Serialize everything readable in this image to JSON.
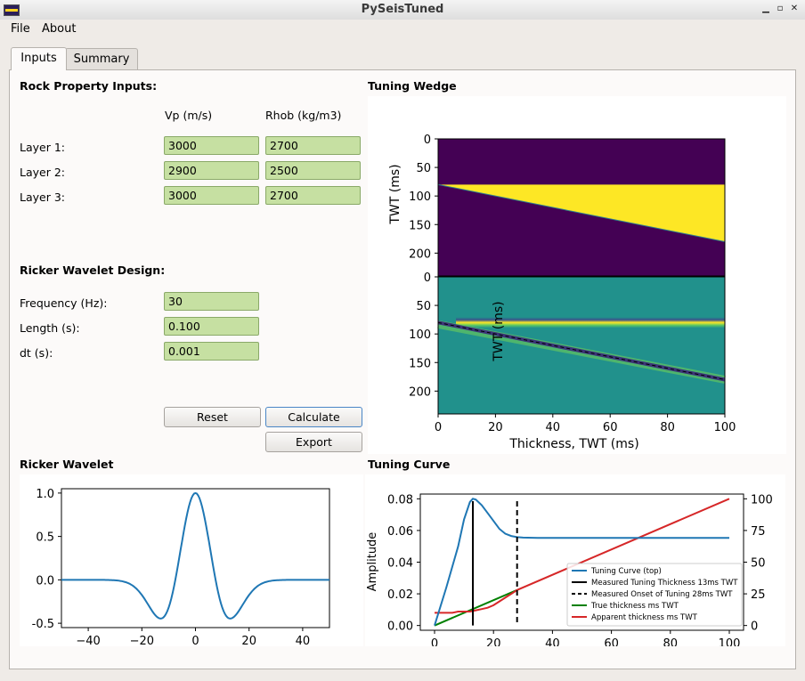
{
  "window": {
    "title": "PySeisTuned"
  },
  "menu": {
    "file": "File",
    "about": "About"
  },
  "tabs": {
    "inputs": "Inputs",
    "summary": "Summary"
  },
  "rock": {
    "heading": "Rock Property Inputs:",
    "col_vp": "Vp (m/s)",
    "col_rhob": "Rhob (kg/m3)",
    "layers": [
      {
        "label": "Layer 1:",
        "vp": "3000",
        "rhob": "2700"
      },
      {
        "label": "Layer 2:",
        "vp": "2900",
        "rhob": "2500"
      },
      {
        "label": "Layer 3:",
        "vp": "3000",
        "rhob": "2700"
      }
    ]
  },
  "wavelet": {
    "heading": "Ricker Wavelet Design:",
    "frequency_label": "Frequency (Hz):",
    "frequency": "30",
    "length_label": "Length (s):",
    "length": "0.100",
    "dt_label": "dt (s):",
    "dt": "0.001"
  },
  "buttons": {
    "reset": "Reset",
    "calculate": "Calculate",
    "export": "Export"
  },
  "sections": {
    "tuning_wedge": "Tuning Wedge",
    "ricker_wavelet": "Ricker Wavelet",
    "tuning_curve": "Tuning Curve"
  },
  "chart_data": [
    {
      "id": "wedge_model",
      "type": "heatmap",
      "ylabel": "TWT (ms)",
      "xlim": [
        0,
        100
      ],
      "ylim": [
        240,
        0
      ],
      "yticks": [
        0,
        50,
        100,
        150,
        200
      ],
      "layers": [
        {
          "name": "top",
          "color": "#440154"
        },
        {
          "name": "wedge",
          "color": "#fde725",
          "top_twt": 80,
          "base_twt_at_0": 80,
          "base_twt_at_100": 180
        },
        {
          "name": "bottom",
          "color": "#440154"
        }
      ]
    },
    {
      "id": "wedge_synthetic",
      "type": "heatmap",
      "ylabel": "TWT (ms)",
      "xlabel": "Thickness, TWT (ms)",
      "xlim": [
        0,
        100
      ],
      "ylim": [
        240,
        0
      ],
      "xticks": [
        0,
        20,
        40,
        60,
        80,
        100
      ],
      "yticks": [
        0,
        50,
        100,
        150,
        200
      ],
      "background": "#21918c",
      "top_reflector_twt": 80,
      "base_reflector_twt": [
        80,
        180
      ]
    },
    {
      "id": "ricker",
      "type": "line",
      "xlim": [
        -50,
        50
      ],
      "ylim": [
        -0.5,
        1.0
      ],
      "xticks": [
        -40,
        -20,
        0,
        20,
        40
      ],
      "yticks": [
        -0.5,
        0.0,
        0.5,
        1.0
      ],
      "frequency_hz": 30,
      "color": "#1f77b4"
    },
    {
      "id": "tuning_curve",
      "type": "line",
      "ylabel": "Amplitude",
      "xlim": [
        0,
        100
      ],
      "xticks": [
        0,
        20,
        40,
        60,
        80,
        100
      ],
      "yticks": [
        0.0,
        0.02,
        0.04,
        0.06,
        0.08
      ],
      "y2ticks": [
        0,
        25,
        50,
        75,
        100
      ],
      "ylim": [
        -0.003,
        0.083
      ],
      "series": [
        {
          "name": "Tuning Curve (top)",
          "color": "#1f77b4",
          "x": [
            0,
            4,
            8,
            10,
            12,
            13,
            14,
            16,
            18,
            20,
            22,
            24,
            26,
            28,
            30,
            35,
            40,
            100
          ],
          "y": [
            0.0,
            0.024,
            0.05,
            0.067,
            0.078,
            0.08,
            0.0795,
            0.076,
            0.071,
            0.066,
            0.061,
            0.058,
            0.0565,
            0.0558,
            0.0555,
            0.0553,
            0.0553,
            0.0553
          ]
        },
        {
          "name": "Measured Tuning Thickness 13ms TWT",
          "color": "#000000",
          "x": 13
        },
        {
          "name": "Measured Onset of Tuning 28ms TWT",
          "color": "#000000",
          "x": 28
        },
        {
          "name": "True thickness ms TWT",
          "color": "#008000"
        },
        {
          "name": "Apparent thickness ms TWT",
          "color": "#d62728"
        }
      ]
    }
  ]
}
